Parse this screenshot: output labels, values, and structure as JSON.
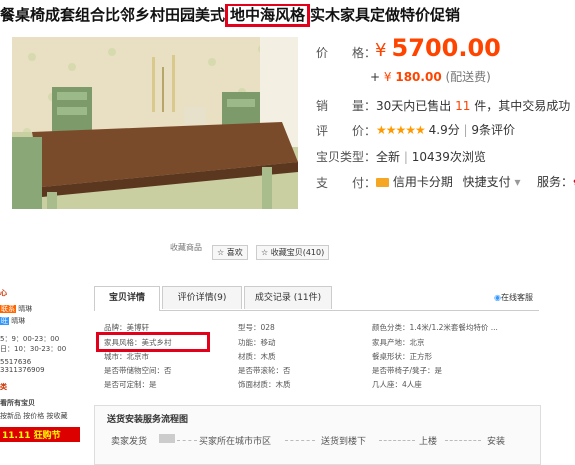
{
  "product": {
    "title_before": "餐桌椅成套组合比邻乡村田园美式",
    "title_boxed": "地中海风格",
    "title_after": "实木家具定做特价促销"
  },
  "info": {
    "price_label": "价　　格：",
    "price_currency": "¥",
    "price_value": "5700.00",
    "shipping_plus": "+",
    "shipping_currency": "¥",
    "shipping_value": "180.00",
    "shipping_note": "(配送费)",
    "sales_label": "销　　量：",
    "sales_prefix": "30天内已售出",
    "sales_count": "11",
    "sales_suffix": "件，其中交易成功",
    "sales_success": "8件",
    "rating_label": "评　　价：",
    "rating_stars": "★★★★★",
    "rating_score": "4.9分",
    "rating_sep": "|",
    "rating_count": "9条评价",
    "type_label": "宝贝类型：",
    "type_value": "全新",
    "type_sep": "|",
    "type_views": "10439次浏览",
    "pay_label": "支　　付：",
    "pay_credit": "信用卡分期",
    "pay_quick": "快捷支付",
    "pay_more": "▾",
    "service_label": "服务："
  },
  "lower": {
    "top_note": "收藏商品",
    "favorite_btn": "☆ 喜欢",
    "collect_btn": "☆ 收藏宝贝(410)",
    "sidebar": {
      "heading1": "心",
      "contact_label": "联系",
      "contact_name": "晴琳",
      "contact_name2": "晴琳",
      "hours1": "5：9：00-23：00",
      "hours2": "日：10：30-23：00",
      "phone1": "5517636",
      "phone2": "3311376909",
      "heading2": "类",
      "all_items": "看所有宝贝",
      "sort1": "按新品",
      "sort2": "按价格",
      "sort3": "按收藏",
      "promo": "11.11 狂购节"
    },
    "tabs": [
      {
        "label": "宝贝详情"
      },
      {
        "label": "评价详情(9)"
      },
      {
        "label": "成交记录 (11件)"
      }
    ],
    "online_service": "在线客服",
    "attributes": [
      [
        "品牌：美博轩",
        "型号：028",
        "颜色分类：1.4米/1.2米套餐均特价 ..."
      ],
      [
        "家具风格：美式乡村",
        "功能：移动",
        "家具产地：北京"
      ],
      [
        "城市：北京市",
        "材质：木质",
        "餐桌形状：正方形"
      ],
      [
        "是否带储物空间：否",
        "是否带滚轮：否",
        "是否带椅子/凳子：是"
      ],
      [
        "是否可定制：是",
        "饰面材质：木质",
        "几人座：4人座"
      ]
    ],
    "delivery": {
      "title": "送货安装服务流程图",
      "steps": [
        "卖家发货",
        "买家所在城市市区",
        "送货到楼下",
        "上楼",
        "安装"
      ]
    }
  },
  "colors": {
    "accent": "#ff4400",
    "highlight_box": "#e3001b"
  }
}
